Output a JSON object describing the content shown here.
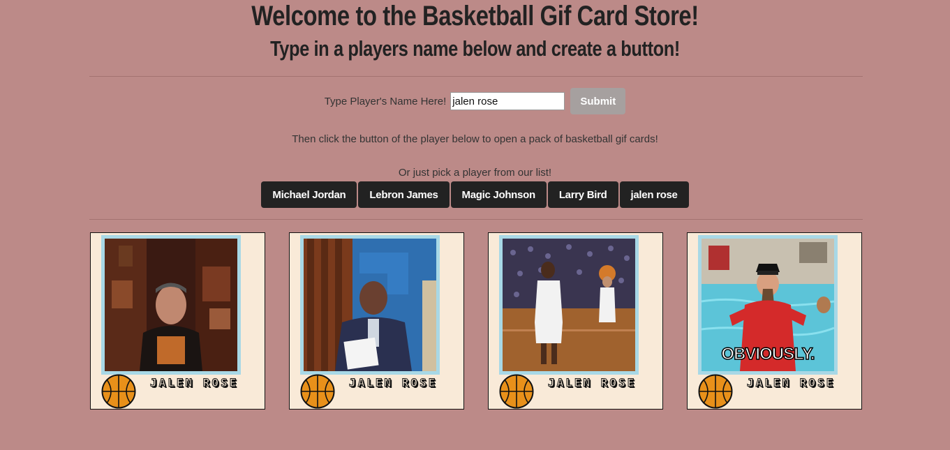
{
  "header": {
    "title": "Welcome to the Basketball Gif Card Store!",
    "subtitle": "Type in a players name below and create a button!"
  },
  "form": {
    "label": "Type Player's Name Here!",
    "input_value": "jalen rose",
    "submit_label": "Submit"
  },
  "instructions": {
    "line1": "Then click the button of the player below to open a pack of basketball gif cards!",
    "line2": "Or just pick a player from our list!"
  },
  "players": [
    {
      "label": "Michael Jordan"
    },
    {
      "label": "Lebron James"
    },
    {
      "label": "Magic Johnson"
    },
    {
      "label": "Larry Bird"
    },
    {
      "label": "jalen rose"
    }
  ],
  "cards": [
    {
      "name": "JALEN ROSE",
      "caption": ""
    },
    {
      "name": "JALEN ROSE",
      "caption": ""
    },
    {
      "name": "JALEN ROSE",
      "caption": ""
    },
    {
      "name": "JALEN ROSE",
      "caption": "OBVIOUSLY."
    }
  ],
  "colors": {
    "background": "#bc8a88",
    "card_bg": "#f9ead8",
    "frame": "#a8d8e6",
    "button_dark": "#222222",
    "submit_bg": "#a6a09f",
    "ball_orange": "#e8901a"
  },
  "icons": {
    "card_icon": "basketball-icon"
  }
}
